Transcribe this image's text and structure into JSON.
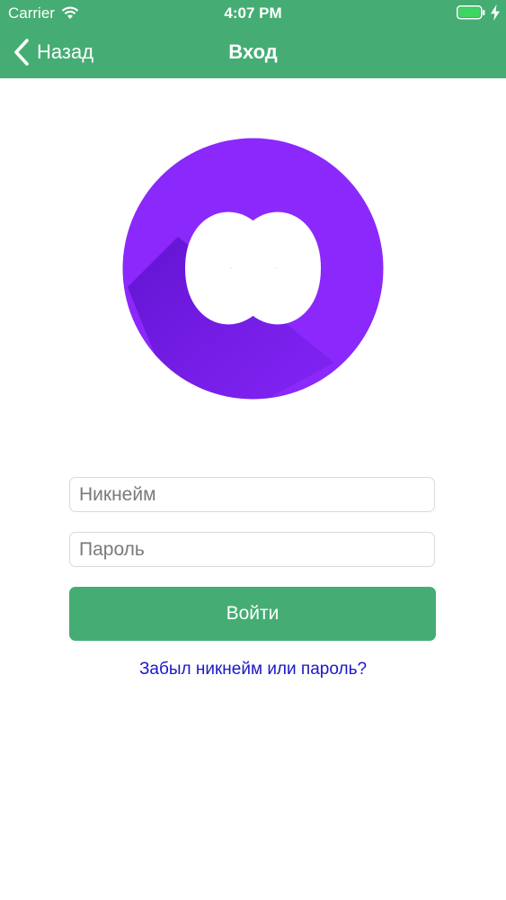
{
  "status_bar": {
    "carrier": "Carrier",
    "time": "4:07 PM",
    "wifi_icon": "wifi-icon",
    "battery_icon": "battery-full-icon",
    "charging_icon": "bolt-icon"
  },
  "nav": {
    "back_label": "Назад",
    "back_icon": "chevron-left-icon",
    "title": "Вход"
  },
  "logo": {
    "icon": "infinity-icon"
  },
  "form": {
    "username_placeholder": "Никнейм",
    "password_placeholder": "Пароль",
    "login_label": "Войти",
    "forgot_link": "Забыл никнейм или пароль?"
  },
  "colors": {
    "brand_green": "#45ad73",
    "logo_purple": "#8b28fb",
    "link_blue": "#1b17c9"
  }
}
